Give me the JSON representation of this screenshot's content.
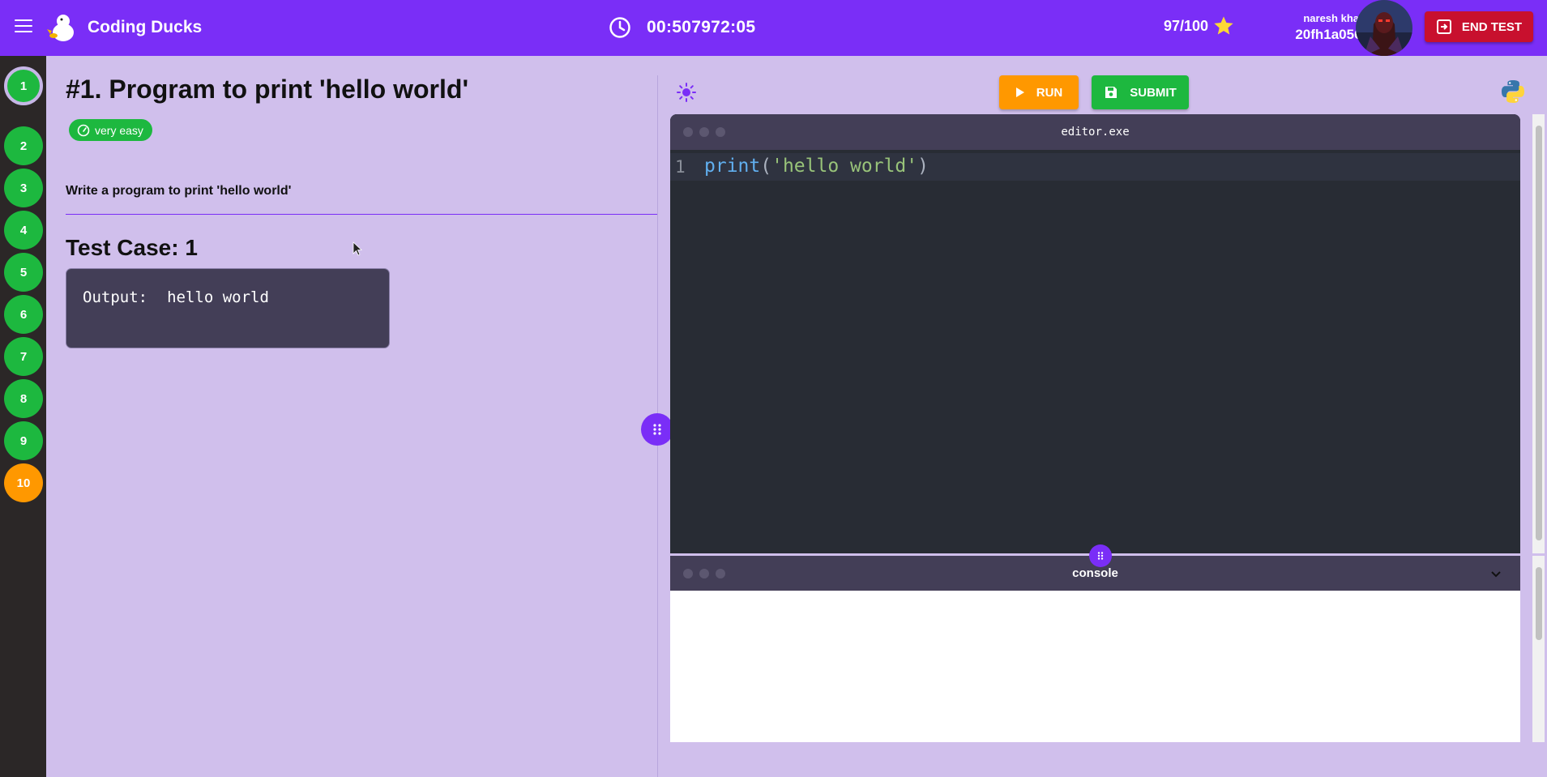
{
  "header": {
    "brand": "Coding Ducks",
    "timer": "00:507972:05",
    "score": "97/100",
    "user_name": "naresh khatri",
    "user_id": "20fh1a0560",
    "end_label": "END TEST"
  },
  "questions": [
    {
      "label": "1",
      "state": "current"
    },
    {
      "label": "2",
      "state": "done"
    },
    {
      "label": "3",
      "state": "done"
    },
    {
      "label": "4",
      "state": "done"
    },
    {
      "label": "5",
      "state": "done"
    },
    {
      "label": "6",
      "state": "done"
    },
    {
      "label": "7",
      "state": "done"
    },
    {
      "label": "8",
      "state": "done"
    },
    {
      "label": "9",
      "state": "done"
    },
    {
      "label": "10",
      "state": "pending"
    }
  ],
  "problem": {
    "title": "#1. Program to print 'hello world'",
    "difficulty": "very easy",
    "description": "Write a program to print 'hello world'",
    "testcase_title": "Test Case: 1",
    "output_label": "Output:",
    "output_value": "hello world"
  },
  "editor": {
    "run_label": "RUN",
    "submit_label": "SUBMIT",
    "window_title": "editor.exe",
    "line_number": "1",
    "code_fn": "print",
    "code_open": "(",
    "code_str": "'hello world'",
    "code_close": ")"
  },
  "console": {
    "title": "console"
  },
  "colors": {
    "primary": "#7a2ef7",
    "success": "#1db83f",
    "warning": "#ff9800",
    "danger": "#c8102e",
    "background": "#d0bfec"
  }
}
